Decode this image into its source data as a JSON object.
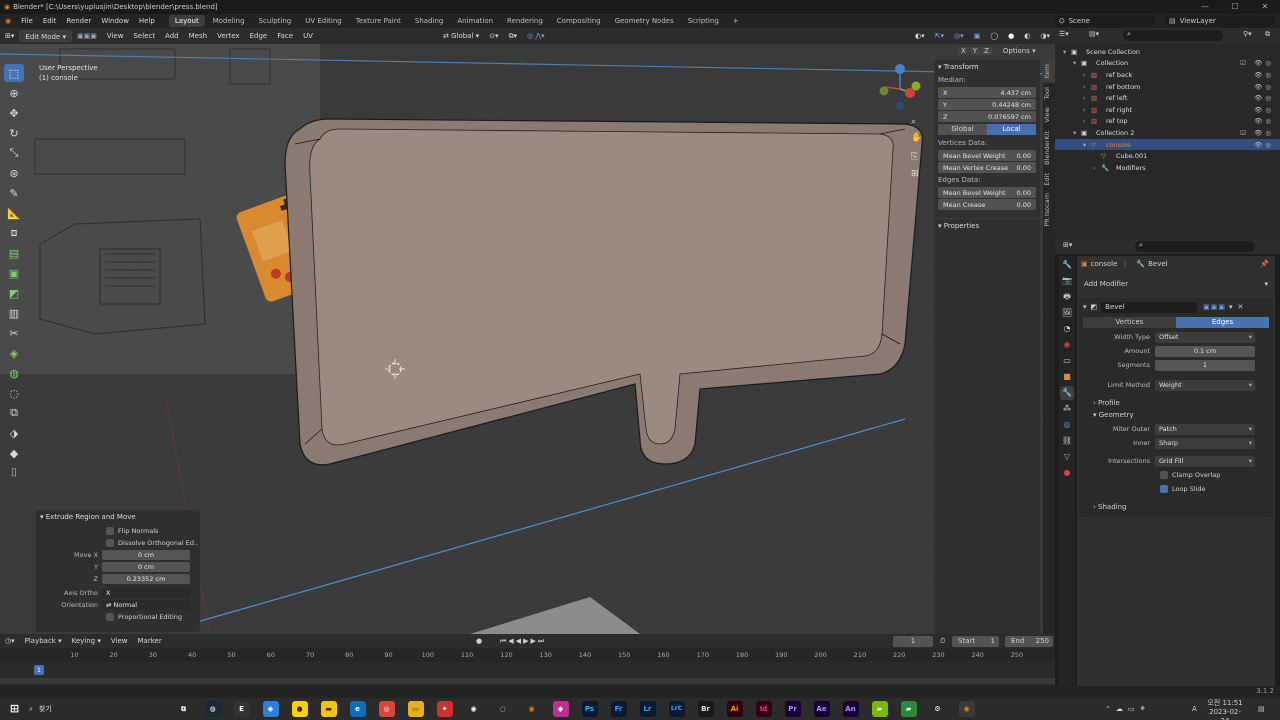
{
  "title": "Blender* [C:\\Users\\yuplusjin\\Desktop\\blender\\press.blend]",
  "menubar": {
    "menus": [
      "File",
      "Edit",
      "Render",
      "Window",
      "Help"
    ],
    "workspaces": [
      "Layout",
      "Modeling",
      "Sculpting",
      "UV Editing",
      "Texture Paint",
      "Shading",
      "Animation",
      "Rendering",
      "Compositing",
      "Geometry Nodes",
      "Scripting"
    ],
    "active_workspace": "Layout",
    "scene": "Scene",
    "view_layer": "ViewLayer"
  },
  "viewport_header": {
    "mode": "Edit Mode",
    "menus": [
      "View",
      "Select",
      "Add",
      "Mesh",
      "Vertex",
      "Edge",
      "Face",
      "UV"
    ],
    "transform_orientation": "Global",
    "options": "Options",
    "axes": [
      "X",
      "Y",
      "Z"
    ]
  },
  "viewport": {
    "perspective": "User Perspective",
    "object": "(1) console"
  },
  "npanel": {
    "transform_title": "Transform",
    "median_label": "Median:",
    "median": [
      {
        "axis": "X",
        "value": "4.437 cm"
      },
      {
        "axis": "Y",
        "value": "0.44248 cm"
      },
      {
        "axis": "Z",
        "value": "0.076597 cm"
      }
    ],
    "toggle": [
      "Global",
      "Local"
    ],
    "toggle_active": "Local",
    "vertices_data": "Vertices Data:",
    "vertex_fields": [
      {
        "label": "Mean Bevel Weight",
        "value": "0.00"
      },
      {
        "label": "Mean Vertex Crease",
        "value": "0.00"
      }
    ],
    "edges_data": "Edges Data:",
    "edge_fields": [
      {
        "label": "Mean Bevel Weight",
        "value": "0.00"
      },
      {
        "label": "Mean Crease",
        "value": "0.00"
      }
    ],
    "properties": "Properties",
    "tabs": [
      "Item",
      "Tool",
      "View",
      "BlenderKit",
      "Edit",
      "PR Isocam"
    ]
  },
  "operator_panel": {
    "title": "Extrude Region and Move",
    "flip_normals": "Flip Normals",
    "dissolve": "Dissolve Orthogonal Ed..",
    "move": [
      {
        "label": "Move X",
        "value": "0 cm"
      },
      {
        "label": "Y",
        "value": "0 cm"
      },
      {
        "label": "Z",
        "value": "0.23352 cm"
      }
    ],
    "axis_ortho_label": "Axis Ortho",
    "axis_ortho": "X",
    "orientation_label": "Orientation",
    "orientation": "Normal",
    "proportional": "Proportional Editing"
  },
  "timeline": {
    "menus": [
      "Playback",
      "Keying",
      "View",
      "Marker"
    ],
    "current_frame": "1",
    "start_label": "Start",
    "start": "1",
    "end_label": "End",
    "end": "250",
    "ticks": [
      "1",
      "10",
      "20",
      "30",
      "40",
      "50",
      "60",
      "70",
      "80",
      "90",
      "100",
      "110",
      "120",
      "130",
      "140",
      "150",
      "160",
      "170",
      "180",
      "190",
      "200",
      "210",
      "220",
      "230",
      "240",
      "250"
    ]
  },
  "outliner": {
    "rows": [
      {
        "label": "Scene Collection",
        "indent": 0,
        "icon": "collection"
      },
      {
        "label": "Collection",
        "indent": 1,
        "icon": "collection"
      },
      {
        "label": "ref back",
        "indent": 2,
        "icon": "image"
      },
      {
        "label": "ref bottom",
        "indent": 2,
        "icon": "image"
      },
      {
        "label": "ref left",
        "indent": 2,
        "icon": "image"
      },
      {
        "label": "ref right",
        "indent": 2,
        "icon": "image"
      },
      {
        "label": "ref top",
        "indent": 2,
        "icon": "image"
      },
      {
        "label": "Collection 2",
        "indent": 1,
        "icon": "collection"
      },
      {
        "label": "console",
        "indent": 2,
        "icon": "mesh",
        "selected": true
      },
      {
        "label": "Cube.001",
        "indent": 3,
        "icon": "mesh-data"
      },
      {
        "label": "Modifiers",
        "indent": 3,
        "icon": "wrench"
      }
    ]
  },
  "properties": {
    "breadcrumb": [
      "console",
      "Bevel"
    ],
    "add_modifier": "Add Modifier",
    "modifier_name": "Bevel",
    "affect": [
      "Vertices",
      "Edges"
    ],
    "affect_active": "Edges",
    "fields": [
      {
        "label": "Width Type",
        "value": "Offset",
        "kind": "dropdown"
      },
      {
        "label": "Amount",
        "value": "0.1 cm",
        "kind": "number"
      },
      {
        "label": "Segments",
        "value": "1",
        "kind": "number"
      },
      {
        "label": "Limit Method",
        "value": "Weight",
        "kind": "dropdown"
      }
    ],
    "profile": "Profile",
    "geometry": "Geometry",
    "geometry_fields": [
      {
        "label": "Miter Outer",
        "value": "Patch"
      },
      {
        "label": "Inner",
        "value": "Sharp"
      },
      {
        "label": "Intersections",
        "value": "Grid Fill"
      }
    ],
    "clamp_overlap": "Clamp Overlap",
    "clamp_checked": false,
    "loop_slide": "Loop Slide",
    "loop_checked": true,
    "shading": "Shading"
  },
  "taskbar": {
    "search": "찾기",
    "time": "오전 11:51",
    "date": "2023-02-24",
    "lang": "A",
    "apps": [
      {
        "name": "Ps",
        "color": "#0a1a33",
        "fg": "#31a8ff"
      },
      {
        "name": "Fr",
        "color": "#0a1a33",
        "fg": "#31a8ff"
      },
      {
        "name": "Lr",
        "color": "#0a1a33",
        "fg": "#31a8ff"
      },
      {
        "name": "LrC",
        "color": "#0a1a33",
        "fg": "#31a8ff"
      },
      {
        "name": "Br",
        "color": "#1a1a1a",
        "fg": "#e0e0e0"
      },
      {
        "name": "Ai",
        "color": "#330000",
        "fg": "#ff9a00"
      },
      {
        "name": "Id",
        "color": "#330018",
        "fg": "#ff3366"
      },
      {
        "name": "Pr",
        "color": "#1a0033",
        "fg": "#9999ff"
      },
      {
        "name": "Ae",
        "color": "#1a0033",
        "fg": "#9999ff"
      },
      {
        "name": "An",
        "color": "#1a0033",
        "fg": "#9999ff"
      }
    ]
  },
  "version": "3.1.2",
  "colors": {
    "accent": "#4772b3",
    "active_object": "#e08a3a",
    "mesh_fill": "#8a7a72"
  }
}
